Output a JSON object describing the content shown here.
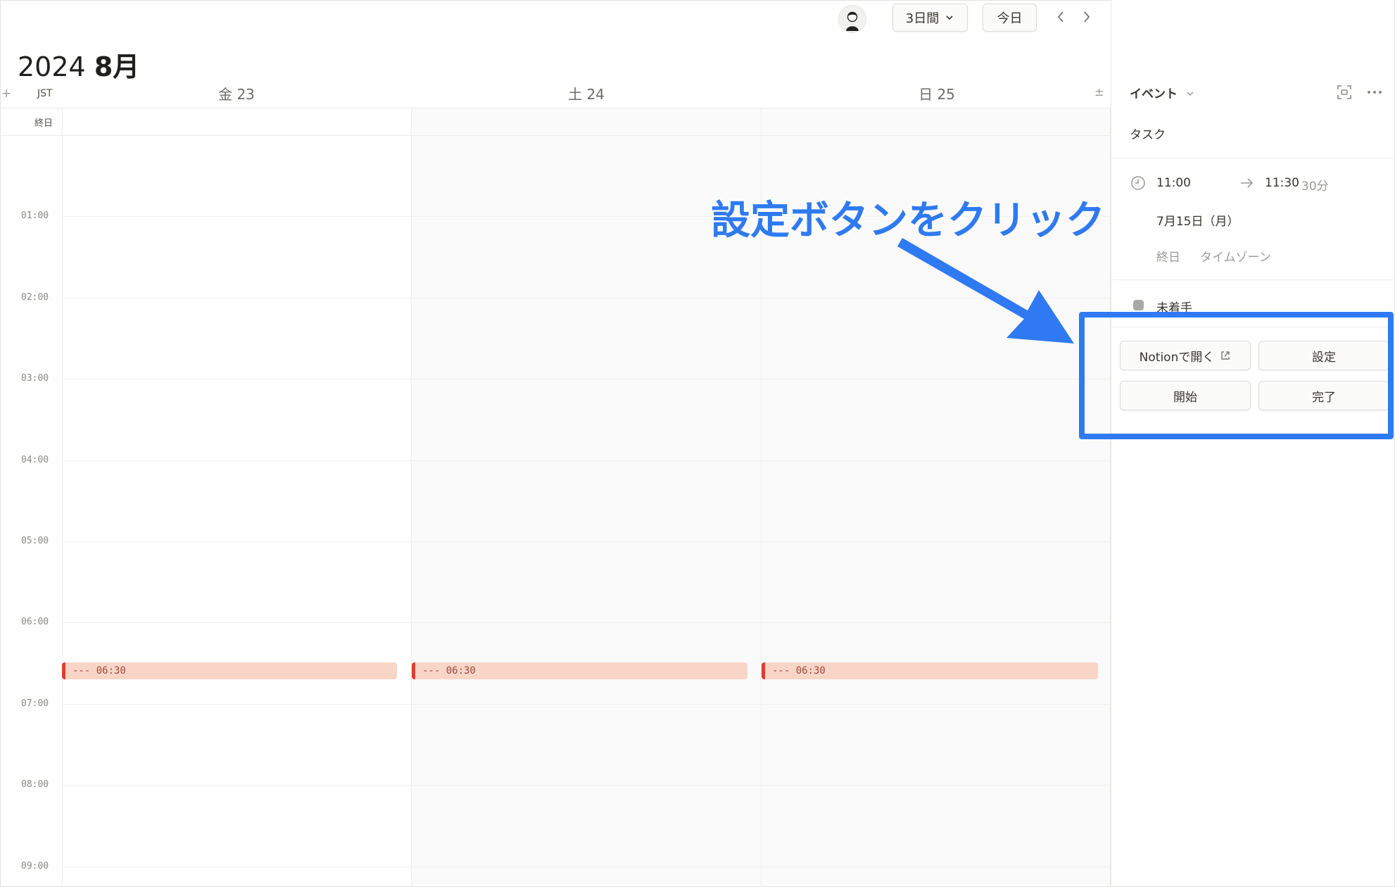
{
  "toolbar": {
    "view_label": "3日間",
    "today_label": "今日"
  },
  "calendar": {
    "year": "2024",
    "month": "8月",
    "timezone": "JST",
    "add_symbol": "+",
    "allday_label": "終日",
    "tz_symbol": "±",
    "days": [
      {
        "weekday": "金",
        "date": "23"
      },
      {
        "weekday": "土",
        "date": "24"
      },
      {
        "weekday": "日",
        "date": "25"
      }
    ],
    "hours": [
      "01:00",
      "02:00",
      "03:00",
      "04:00",
      "05:00",
      "06:00",
      "07:00",
      "08:00",
      "09:00"
    ],
    "events": [
      {
        "label": "--- 06:30",
        "color": "#f9d5c7",
        "accent": "#e03e2d"
      },
      {
        "label": "--- 06:30",
        "color": "#f9d5c7",
        "accent": "#e03e2d"
      },
      {
        "label": "--- 06:30",
        "color": "#f9d5c7",
        "accent": "#e03e2d"
      }
    ]
  },
  "panel": {
    "type_label": "イベント",
    "task_title": "タスク",
    "start_time": "11:00",
    "end_time": "11:30",
    "duration": "30分",
    "date": "7月15日（月）",
    "allday_label": "終日",
    "timezone_label": "タイムゾーン",
    "status": "未着手",
    "status_color": "#a8a8a6",
    "buttons": {
      "open_notion": "Notionで開く",
      "settings": "設定",
      "start": "開始",
      "complete": "完了"
    }
  },
  "annotation": {
    "text": "設定ボタンをクリック",
    "color": "#2f7af2"
  }
}
